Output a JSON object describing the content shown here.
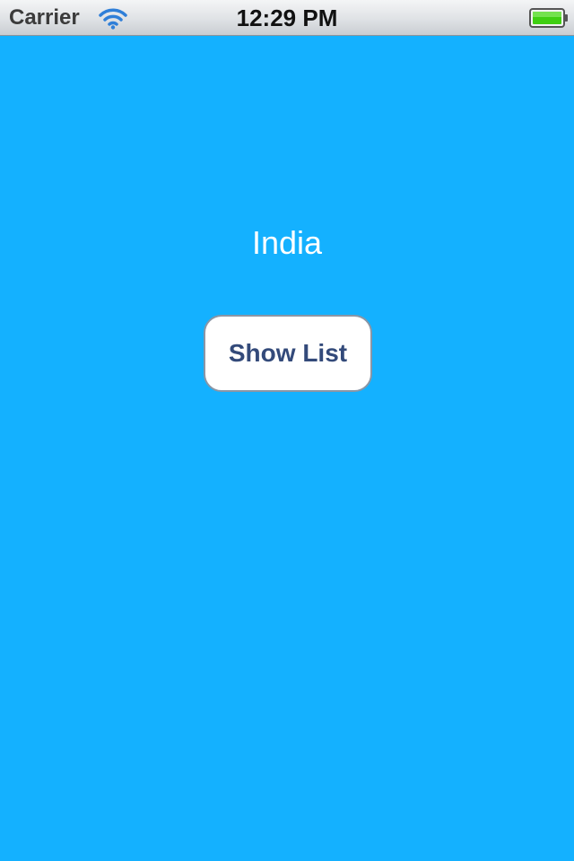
{
  "status_bar": {
    "carrier": "Carrier",
    "time": "12:29 PM",
    "wifi_icon": "wifi-icon",
    "battery_icon": "battery-full-icon",
    "battery_color": "#3fcf12"
  },
  "main": {
    "background_color": "#14b1ff",
    "country_label": "India",
    "show_list_label": "Show List",
    "button_text_color": "#334a7a"
  }
}
